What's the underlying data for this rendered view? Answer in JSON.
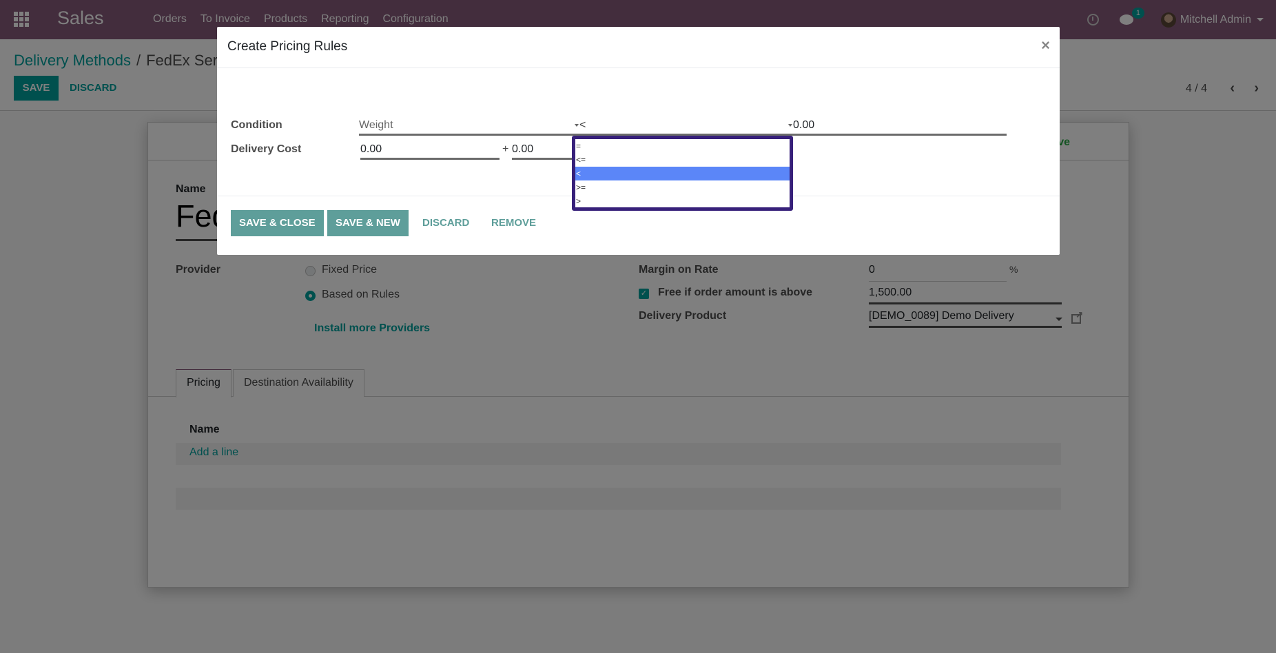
{
  "navbar": {
    "app_name": "Sales",
    "menu": [
      "Orders",
      "To Invoice",
      "Products",
      "Reporting",
      "Configuration"
    ],
    "messages_count": "1",
    "user_name": "Mitchell Admin"
  },
  "control_panel": {
    "breadcrumb_parent": "Delivery Methods",
    "breadcrumb_separator": "/",
    "breadcrumb_current": "FedEx Ser",
    "save_label": "SAVE",
    "discard_label": "DISCARD",
    "pager": "4 / 4"
  },
  "form": {
    "active_label": "tive",
    "name_label": "Name",
    "name_value": "Fed",
    "provider_label": "Provider",
    "provider_options": [
      "Fixed Price",
      "Based on Rules"
    ],
    "provider_selected": "Based on Rules",
    "install_more": "Install more Providers",
    "margin_label": "Margin on Rate",
    "margin_value": "0",
    "margin_unit": "%",
    "free_label": "Free if order amount is above",
    "free_checked": true,
    "free_value": "1,500.00",
    "delivery_product_label": "Delivery Product",
    "delivery_product_value": "[DEMO_0089] Demo Delivery",
    "tabs": [
      "Pricing",
      "Destination Availability"
    ],
    "active_tab": "Pricing",
    "list_column": "Name",
    "add_line": "Add a line"
  },
  "modal": {
    "title": "Create Pricing Rules",
    "close": "×",
    "condition_label": "Condition",
    "condition_variable": "Weight",
    "condition_operator": "<",
    "condition_value": "0.00",
    "delivery_cost_label": "Delivery Cost",
    "cost_base": "0.00",
    "plus": "+",
    "cost_extra": "0.00",
    "buttons": {
      "save_close": "SAVE & CLOSE",
      "save_new": "SAVE & NEW",
      "discard": "DISCARD",
      "remove": "REMOVE"
    },
    "operator_options": [
      "=",
      "<=",
      "<",
      ">=",
      ">"
    ],
    "operator_selected_index": 2
  },
  "colors": {
    "navbar": "#875a7b",
    "accent": "#00a09d",
    "modal_button": "#5e9e9a",
    "dropdown_border": "#37207a",
    "dropdown_highlight": "#5b86f8"
  }
}
